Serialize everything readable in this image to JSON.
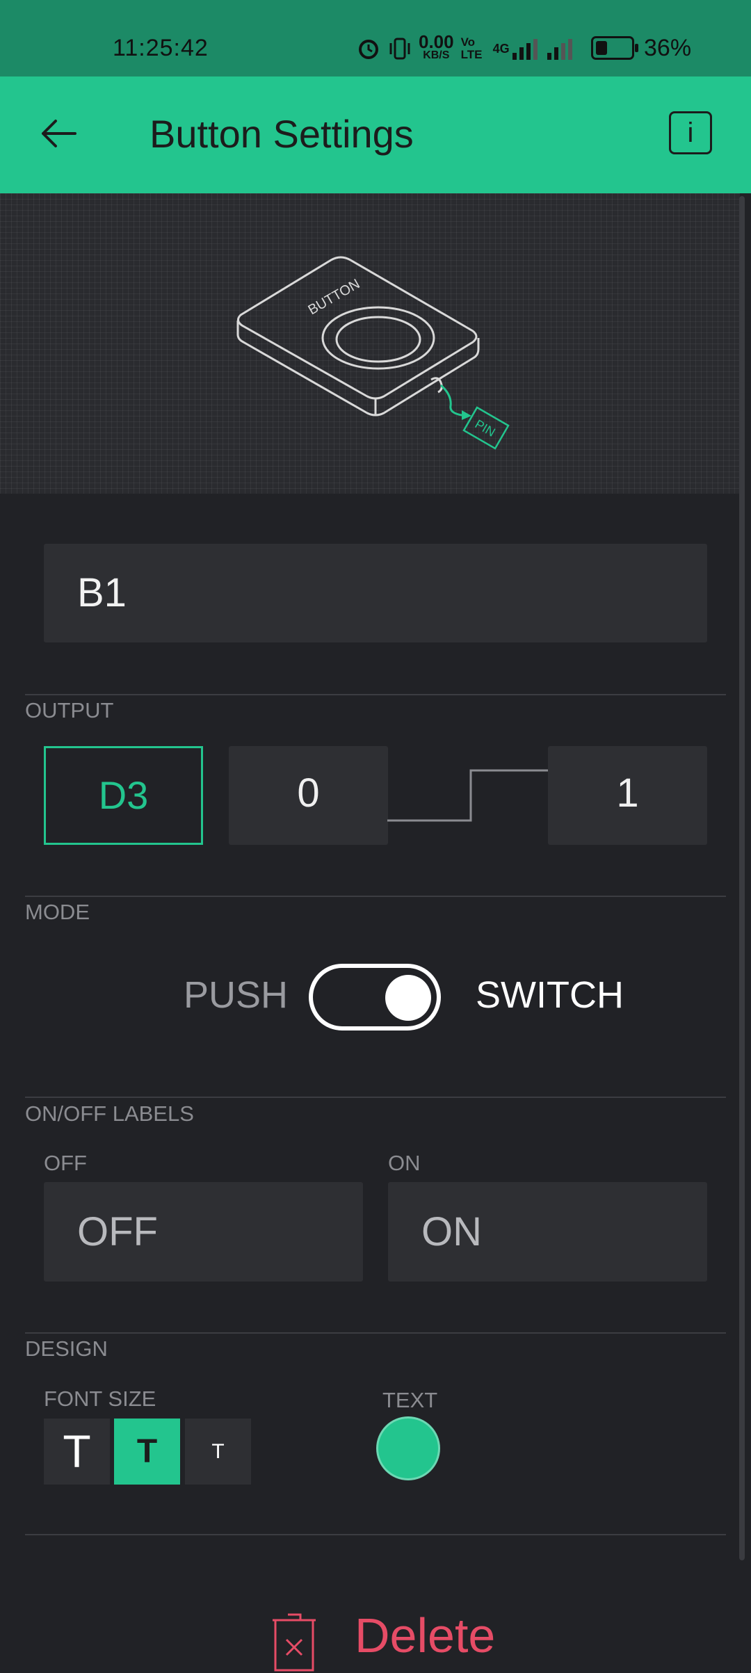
{
  "status_bar": {
    "time": "11:25:42",
    "speed_value": "0.00",
    "speed_unit": "KB/S",
    "volte": "Vo LTE",
    "network": "4G",
    "battery_percent": "36%",
    "battery_level": 0.36
  },
  "app_bar": {
    "title": "Button Settings",
    "info_label": "i"
  },
  "hero": {
    "device_label": "BUTTON",
    "pin_label": "PIN"
  },
  "name_field": {
    "value": "B1"
  },
  "output": {
    "section_label": "OUTPUT",
    "pin": "D3",
    "low_value": "0",
    "high_value": "1"
  },
  "mode": {
    "section_label": "MODE",
    "push_label": "PUSH",
    "switch_label": "SWITCH",
    "selected": "SWITCH"
  },
  "labels": {
    "section_label": "ON/OFF LABELS",
    "off_caption": "OFF",
    "off_value": "OFF",
    "on_caption": "ON",
    "on_value": "ON"
  },
  "design": {
    "section_label": "DESIGN",
    "font_size_caption": "FONT SIZE",
    "font_sizes": [
      {
        "glyph": "T",
        "size": "large",
        "active": false
      },
      {
        "glyph": "T",
        "size": "medium",
        "active": true
      },
      {
        "glyph": "T",
        "size": "small",
        "active": false
      }
    ],
    "text_color_caption": "TEXT",
    "text_color": "#23c58e"
  },
  "delete_label": "Delete",
  "colors": {
    "accent": "#23c58e",
    "status_bar": "#1c8a66",
    "background": "#212226",
    "field": "#2e2f33",
    "delete": "#e64c66"
  }
}
